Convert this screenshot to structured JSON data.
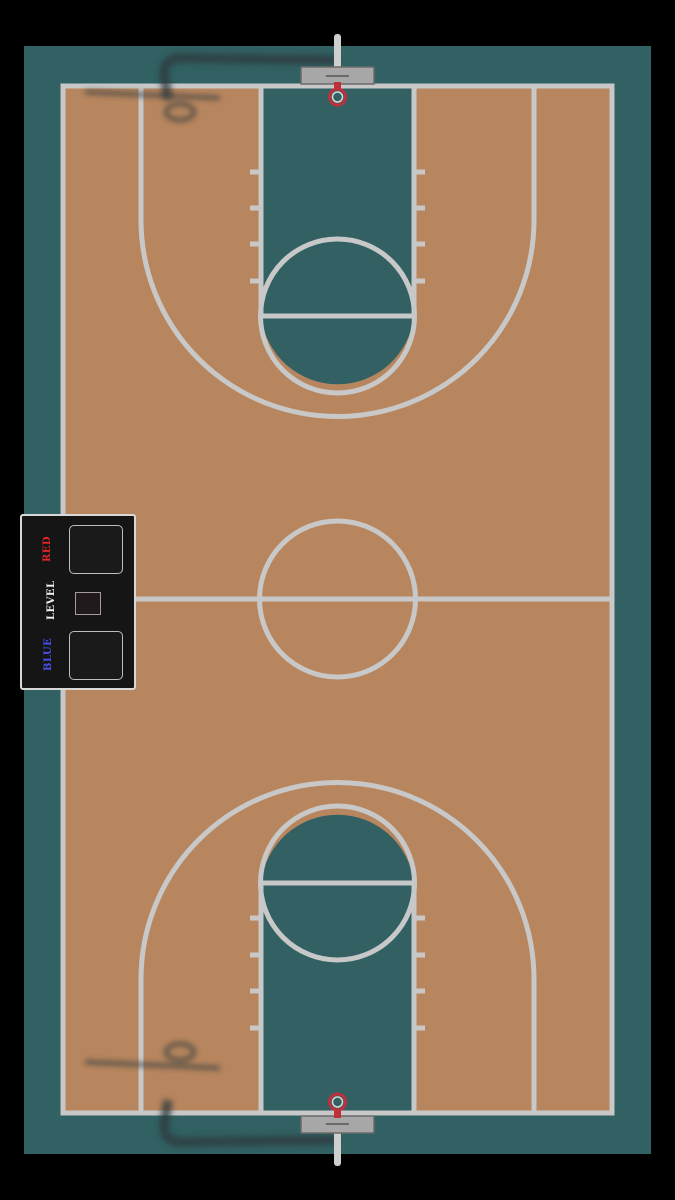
{
  "game": {
    "scene": "basketball-court-top-down",
    "colors": {
      "background": "#000000",
      "apron": "#316163",
      "court_wood": "#b8865e",
      "paint": "#326063",
      "lines": "#c8c8c8",
      "rim": "#c0303a",
      "backboard": "#a7a7a7"
    }
  },
  "scoreboard": {
    "red_label": "RED",
    "level_label": "LEVEL",
    "blue_label": "BLUE",
    "red_score": "",
    "level_value": "",
    "blue_score": "",
    "red_color": "#e0242a",
    "blue_color": "#4a4ff0"
  }
}
